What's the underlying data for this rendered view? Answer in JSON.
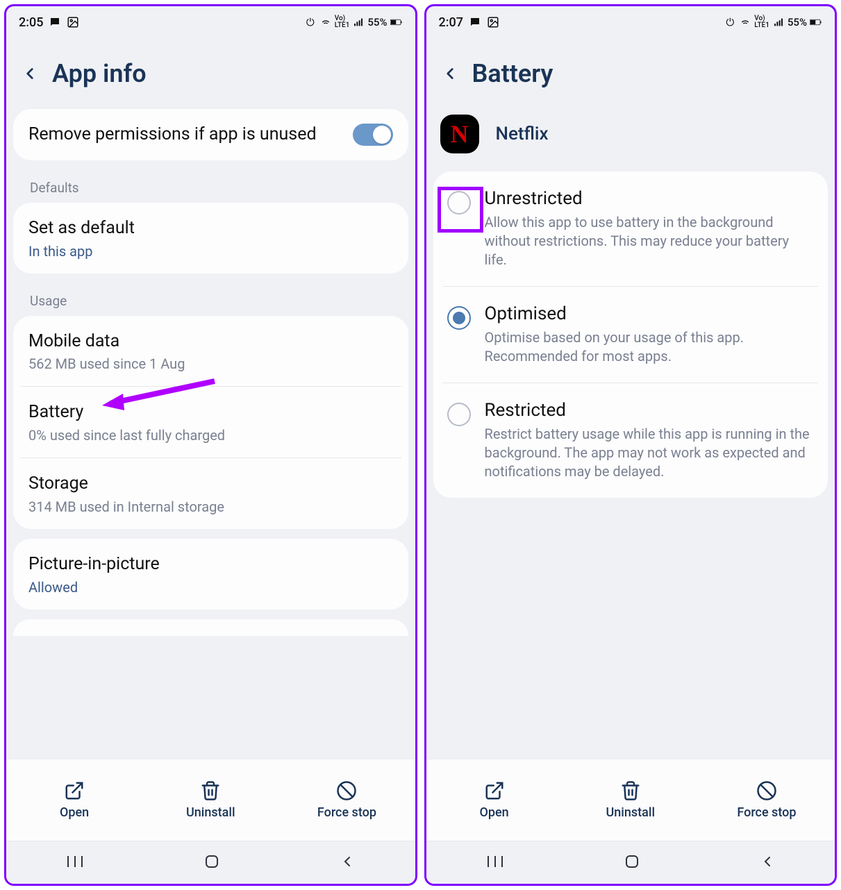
{
  "left": {
    "status": {
      "time": "2:05",
      "battery": "55%"
    },
    "header": {
      "title": "App info"
    },
    "remove_perms": {
      "label": "Remove permissions if app is unused"
    },
    "sections": {
      "defaults": {
        "label": "Defaults"
      },
      "usage": {
        "label": "Usage"
      }
    },
    "set_default": {
      "title": "Set as default",
      "sub": "In this app"
    },
    "mobile_data": {
      "title": "Mobile data",
      "sub": "562 MB used since 1 Aug"
    },
    "battery": {
      "title": "Battery",
      "sub": "0% used since last fully charged"
    },
    "storage": {
      "title": "Storage",
      "sub": "314 MB used in Internal storage"
    },
    "pip": {
      "title": "Picture-in-picture",
      "sub": "Allowed"
    },
    "actions": {
      "open": "Open",
      "uninstall": "Uninstall",
      "force_stop": "Force stop"
    }
  },
  "right": {
    "status": {
      "time": "2:07",
      "battery": "55%"
    },
    "header": {
      "title": "Battery"
    },
    "app": {
      "name": "Netflix"
    },
    "options": {
      "unrestricted": {
        "title": "Unrestricted",
        "desc": "Allow this app to use battery in the background without restrictions. This may reduce your battery life."
      },
      "optimised": {
        "title": "Optimised",
        "desc": "Optimise based on your usage of this app. Recommended for most apps."
      },
      "restricted": {
        "title": "Restricted",
        "desc": "Restrict battery usage while this app is running in the background. The app may not work as expected and notifications may be delayed."
      }
    },
    "actions": {
      "open": "Open",
      "uninstall": "Uninstall",
      "force_stop": "Force stop"
    }
  }
}
